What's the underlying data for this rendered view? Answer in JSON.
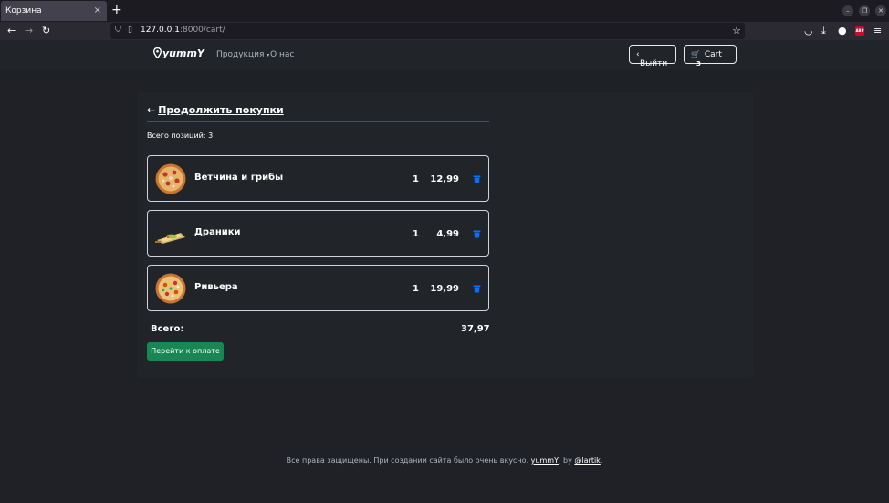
{
  "browser": {
    "tab_title": "Корзина",
    "tab_close": "×",
    "new_tab": "+",
    "url_host": "127.0.0.1",
    "url_rest": ":8000/cart/",
    "abp_label": "ABP"
  },
  "site": {
    "brand": "yummY",
    "menu_products": "Продукция",
    "menu_about": "О нас",
    "logout_label": "Выйти",
    "cart_label": "Cart",
    "cart_count": "3"
  },
  "cart": {
    "back_label": "Продолжить покупки",
    "count_text": "Всего позиций: 3",
    "items": [
      {
        "name": "Ветчина и грибы",
        "qty": "1",
        "price": "12,99"
      },
      {
        "name": "Драники",
        "qty": "1",
        "price": "4,99"
      },
      {
        "name": "Ривьера",
        "qty": "1",
        "price": "19,99"
      }
    ],
    "total_label": "Всего:",
    "total_value": "37,97",
    "checkout_label": "Перейти к оплате"
  },
  "footer": {
    "text": "Все права защищены. При создании сайта было очень вкусно. ",
    "brand_link": "yummY",
    "by_text": ", by ",
    "author_link": "@lartik",
    "end": "."
  },
  "colors": {
    "accent_green": "#198754",
    "trash_blue": "#0d6efd",
    "page_bg": "#1f2126"
  }
}
